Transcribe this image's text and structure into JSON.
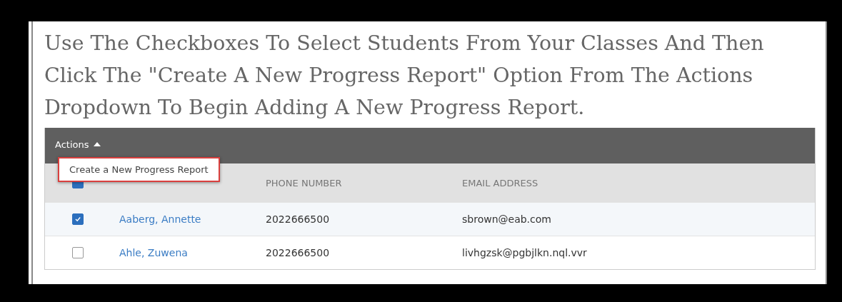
{
  "instructions": "Use The Checkboxes To Select Students From Your Classes And Then Click The \"Create A New Progress Report\" Option From The Actions Dropdown To Begin Adding A New Progress Report.",
  "toolbar": {
    "actions_label": "Actions",
    "expanded": true
  },
  "actions_menu": [
    {
      "label": "Create a New Progress Report",
      "highlighted": true
    }
  ],
  "table": {
    "select_all_checked": true,
    "columns": [
      {
        "label": "PHONE NUMBER"
      },
      {
        "label": "EMAIL ADDRESS"
      }
    ],
    "rows": [
      {
        "checked": true,
        "name": "Aaberg, Annette",
        "phone": "2022666500",
        "email": "sbrown@eab.com"
      },
      {
        "checked": false,
        "name": "Ahle, Zuwena",
        "phone": "2022666500",
        "email": "livhgzsk@pgbjlkn.nql.vvr"
      }
    ]
  }
}
